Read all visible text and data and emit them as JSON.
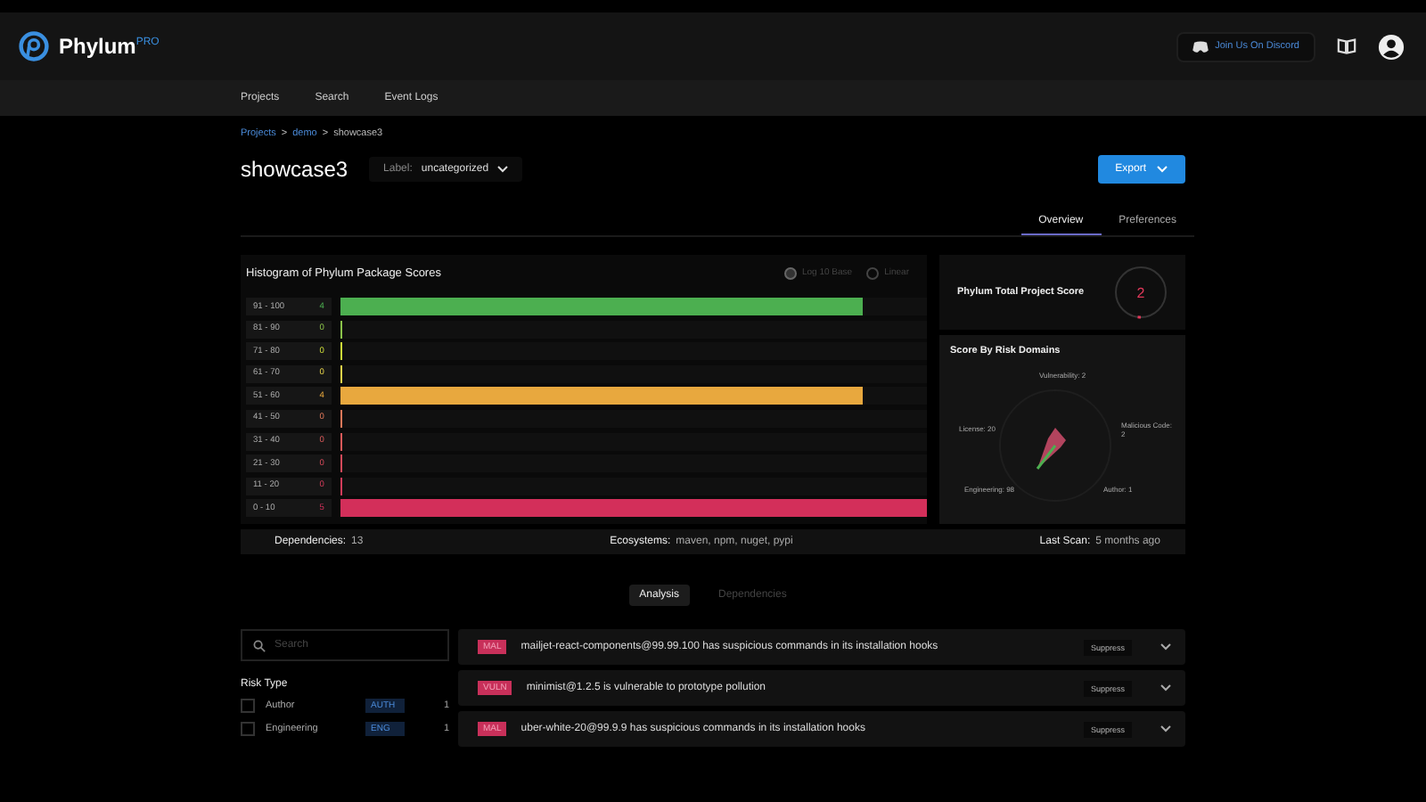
{
  "header": {
    "brand": "Phylum$^{PRO}$",
    "discord_button": "Join Us On Discord"
  },
  "nav": [
    "Projects",
    "Search",
    "Event Logs"
  ],
  "breadcrumb": [
    {
      "label": "Projects",
      "kind": "link"
    },
    {
      "label": ">",
      "kind": "separator"
    },
    {
      "label": "demo",
      "kind": "link"
    },
    {
      "label": ">",
      "kind": "separator"
    },
    {
      "label": "showcase3",
      "kind": "current"
    }
  ],
  "project": {
    "title": "showcase3",
    "label_caption": "Label:",
    "label_value": "uncategorized",
    "export_button": "Export"
  },
  "tabs": [
    {
      "label": "Overview",
      "selected": true
    },
    {
      "label": "Preferences",
      "selected": false
    }
  ],
  "histogram": {
    "scale_options": [
      {
        "label": "Log 10 Base",
        "selected": true
      },
      {
        "label": "Linear",
        "selected": false
      }
    ],
    "title": "Histogram of Phylum Package Scores",
    "bins": [
      {
        "label": "91 - 100",
        "count": "4",
        "level": 0.89
      },
      {
        "label": "81 - 90",
        "count": "0",
        "level": 0
      },
      {
        "label": "71 - 80",
        "count": "0",
        "level": 0
      },
      {
        "label": "61 - 70",
        "count": "0",
        "level": 0
      },
      {
        "label": "51 - 60",
        "count": "4",
        "level": 0.89
      },
      {
        "label": "41 - 50",
        "count": "0",
        "level": 0
      },
      {
        "label": "31 - 40",
        "count": "0",
        "level": 0
      },
      {
        "label": "21 - 30",
        "count": "0",
        "level": 0
      },
      {
        "label": "11 - 20",
        "count": "0",
        "level": 0
      },
      {
        "label": "0 - 10",
        "count": "5",
        "level": 1
      }
    ]
  },
  "total_score": {
    "title": "Phylum Total Project Score",
    "value": "2",
    "level": 0.02
  },
  "risk_domains": {
    "title": "Score By Risk Domains",
    "labels": [
      "Vulnerability: 2",
      "License: 20",
      "Malicious Code: 2",
      "Engineering: 98",
      "Author: 1"
    ]
  },
  "stats": [
    {
      "name": "Dependencies:",
      "value": "13"
    },
    {
      "name": "Ecosystems:",
      "value": "maven, npm, nuget, pypi"
    },
    {
      "name": "Last Scan:",
      "value": "5 months ago"
    }
  ],
  "section_tabs": [
    {
      "label": "Analysis",
      "selected": true
    },
    {
      "label": "Dependencies",
      "selected": false
    }
  ],
  "search": {
    "placeholder": "Search"
  },
  "risk_type": {
    "title": "Risk Type",
    "items": [
      {
        "name": "Author",
        "tag": "AUTH",
        "count": "1",
        "checked": false
      },
      {
        "name": "Engineering",
        "tag": "ENG",
        "count": "1",
        "checked": false
      }
    ]
  },
  "issues": [
    {
      "tag": "MAL",
      "text": "mailjet-react-components@99.99.100 has suspicious commands in its installation hooks",
      "action": "Suppress"
    },
    {
      "tag": "VULN",
      "text": "minimist@1.2.5 is vulnerable to prototype pollution",
      "action": "Suppress"
    },
    {
      "tag": "MAL",
      "text": "uber-white-20@99.9.9 has suspicious commands in its installation hooks",
      "action": "Suppress"
    }
  ]
}
